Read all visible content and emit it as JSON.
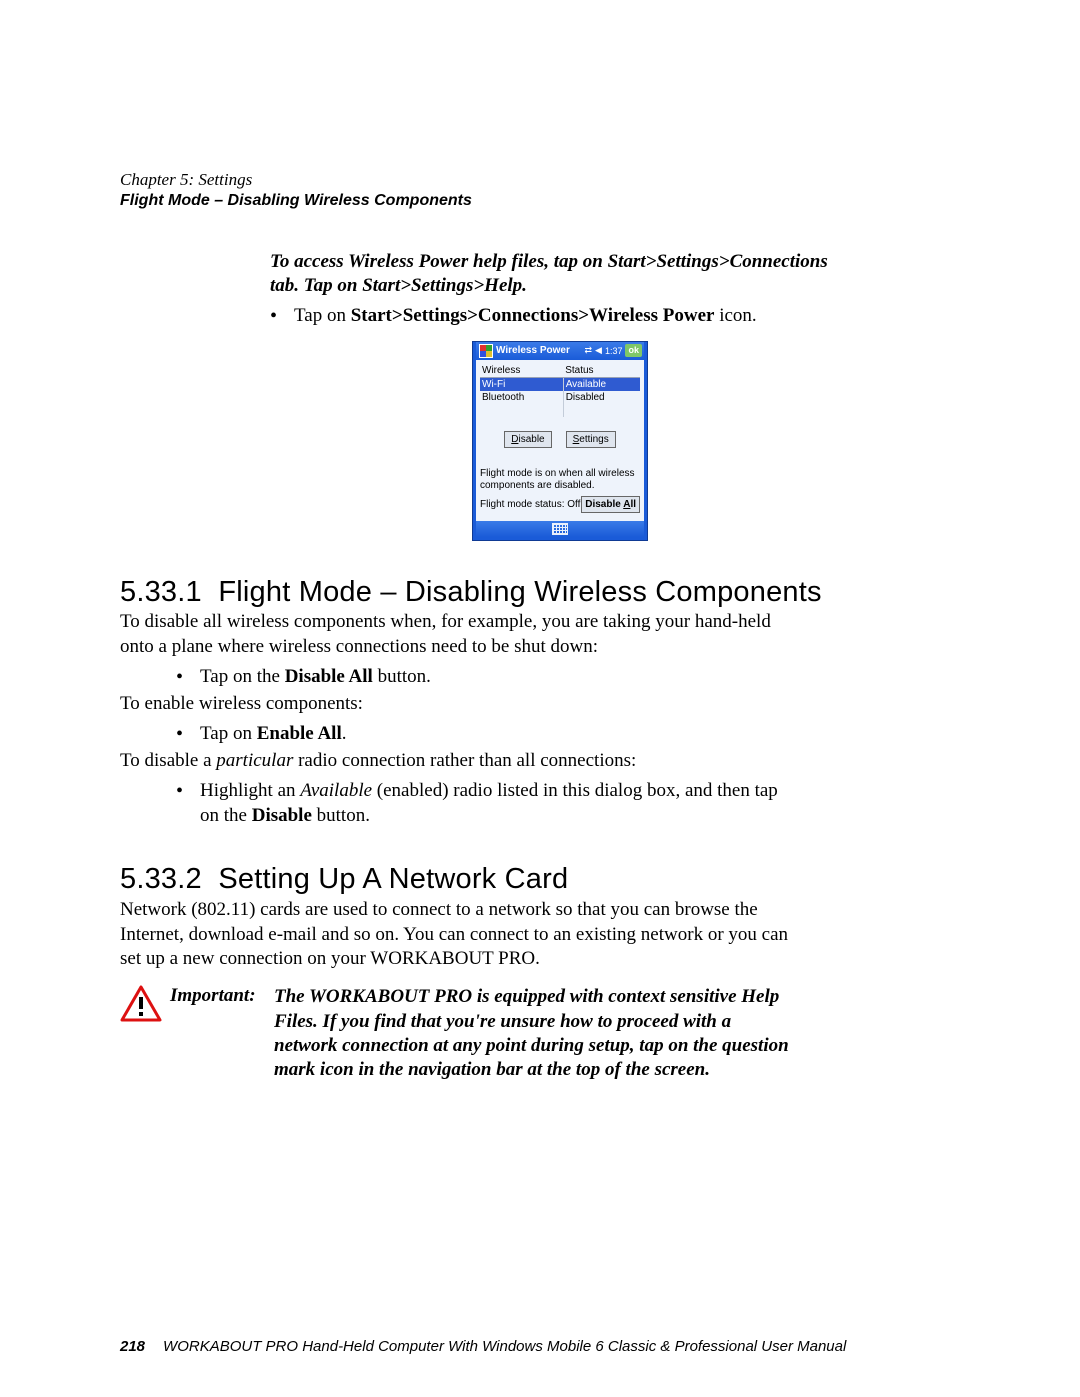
{
  "chapter_line": "Chapter 5:  Settings",
  "subtitle_line": "Flight Mode – Disabling Wireless Components",
  "help_note": "To access Wireless Power help files, tap on Start>Settings>Connections tab. Tap on Start>Settings>Help.",
  "access_path_prefix": "Tap on ",
  "access_path_bold": "Start>Settings>Connections>Wireless Power",
  "access_path_suffix": " icon.",
  "screenshot": {
    "title": "Wireless Power",
    "clock": "1:37",
    "ok": "ok",
    "columns": [
      "Wireless",
      "Status"
    ],
    "rows": [
      {
        "name": "Wi-Fi",
        "status": "Available",
        "selected": true
      },
      {
        "name": "Bluetooth",
        "status": "Disabled",
        "selected": false
      }
    ],
    "disable_btn": "Disable",
    "settings_btn": "Settings",
    "flight_note": "Flight mode is on when all wireless components are disabled.",
    "flight_status_label": "Flight mode status: Off",
    "disable_all_btn": "Disable All"
  },
  "section_5331_num": "5.33.1",
  "section_5331_title": "Flight Mode – Disabling Wireless Components",
  "p_5331_intro": "To disable all wireless components when, for example, you are taking your hand-held onto a plane where wireless connections need to be shut down:",
  "b_tap_on_the": "Tap on the ",
  "b_disable_all": "Disable All",
  "b_button_suffix": " button.",
  "p_enable_intro": "To enable wireless components:",
  "b_tap_on": "Tap on ",
  "b_enable_all": "Enable All",
  "p_particular_prefix": "To disable a ",
  "p_particular_word": "particular",
  "p_particular_suffix": " radio connection rather than all connections:",
  "b_highlight_prefix": "Highlight an ",
  "b_available": "Available",
  "b_highlight_mid": " (enabled) radio listed in this dialog box, and then tap on the ",
  "b_disable": "Disable",
  "section_5332_num": "5.33.2",
  "section_5332_title": "Setting Up A Network Card",
  "p_5332": "Network (802.11) cards are used to connect to a network so that you can browse the Internet, download e-mail and so on. You can connect to an existing network or you can set up a new connection on your WORKABOUT PRO.",
  "important_label": "Important:",
  "important_text": "The WORKABOUT PRO is equipped with context sensitive Help Files. If you find that you're unsure how to proceed with a network connection at any point during setup, tap on the question mark icon in the navigation bar at the top of the screen.",
  "footer_page": "218",
  "footer_text": "WORKABOUT PRO Hand-Held Computer With Windows Mobile 6 Classic & Professional User Manual"
}
